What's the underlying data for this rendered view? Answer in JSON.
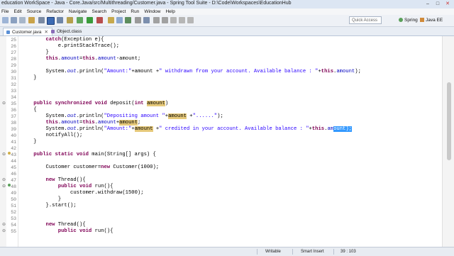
{
  "window": {
    "title": "education WorkSpace - Java - Core.Java/src/Multithreading/Customer.java - Spring Tool Suite - D:\\Code\\Workspaces\\EducationHub",
    "buttons": [
      "–",
      "□",
      "✕"
    ]
  },
  "menu": [
    "File",
    "Edit",
    "Source",
    "Refactor",
    "Navigate",
    "Search",
    "Project",
    "Run",
    "Window",
    "Help"
  ],
  "toolbar": {
    "quick_access_placeholder": "Quick Access",
    "perspectives": [
      {
        "label": "Spring",
        "icon": "spring-leaf-icon"
      },
      {
        "label": "Java EE",
        "icon": "java-ee-icon"
      }
    ]
  },
  "tabs": [
    {
      "label": "Customer.java",
      "icon": "java-file-icon",
      "active": true
    },
    {
      "label": "Object.class",
      "icon": "class-file-icon",
      "active": false
    }
  ],
  "code_lines": [
    {
      "num": "25",
      "html": "        <span class=\"kw\">catch</span>(Exception e){"
    },
    {
      "num": "26",
      "html": "            e.printStackTrace();"
    },
    {
      "num": "27",
      "html": "        }"
    },
    {
      "num": "28",
      "html": "        <span class=\"kw\">this</span>.<span class=\"fld\">amount</span>=<span class=\"kw\">this</span>.<span class=\"fld\">amount</span>-amount;"
    },
    {
      "num": "29",
      "html": ""
    },
    {
      "num": "30",
      "html": "        System.<span class=\"fld\"><i>out</i></span>.println(<span class=\"str\">\"Amount:\"</span>+amount +<span class=\"str\">\" withdrawn from your account. Available balance : \"</span>+<span class=\"kw\">this</span>.<span class=\"fld\">amount</span>);"
    },
    {
      "num": "31",
      "html": "    }"
    },
    {
      "num": "32",
      "html": ""
    },
    {
      "num": "33",
      "html": ""
    },
    {
      "num": "34",
      "html": ""
    },
    {
      "num": "35",
      "html": "    <span class=\"kw\">public</span> <span class=\"kw\">synchronized</span> <span class=\"kw\">void</span> deposit(<span class=\"kw\">int</span> <span class=\"hl\">amount</span>)",
      "fold": "⊖"
    },
    {
      "num": "36",
      "html": "    {"
    },
    {
      "num": "37",
      "html": "        System.<span class=\"fld\"><i>out</i></span>.println(<span class=\"str\">\"Depositing amount \"</span>+<span class=\"hl\">amount</span> +<span class=\"str\">\"......\"</span>);"
    },
    {
      "num": "38",
      "html": "        <span class=\"kw\">this</span>.<span class=\"fld\">amount</span>=<span class=\"kw\">this</span>.<span class=\"fld\">amount</span>+<span class=\"hl\">amount</span>;"
    },
    {
      "num": "39",
      "html": "        System.<span class=\"fld\"><i>out</i></span>.println(<span class=\"str\">\"Amount:\"</span>+<span class=\"hl\">amount</span> +<span class=\"str\">\" credited in your account. Available balance : \"</span>+<span class=\"kw\">this</span>.<span class=\"fld\">am</span><span class=\"sel\">ount);</span>"
    },
    {
      "num": "40",
      "html": "        notifyAll();"
    },
    {
      "num": "41",
      "html": "    }"
    },
    {
      "num": "42",
      "html": ""
    },
    {
      "num": "43",
      "html": "    <span class=\"kw\">public</span> <span class=\"kw\">static</span> <span class=\"kw\">void</span> main(String[] args) {",
      "fold": "⊖"
    },
    {
      "num": "44",
      "html": ""
    },
    {
      "num": "45",
      "html": "        Customer customer=<span class=\"kw\">new</span> Customer(1000);"
    },
    {
      "num": "46",
      "html": ""
    },
    {
      "num": "47",
      "html": "        <span class=\"kw\">new</span> Thread(){",
      "fold": "⊖"
    },
    {
      "num": "48",
      "html": "            <span class=\"kw\">public</span> <span class=\"kw\">void</span> run(){",
      "fold": "⊖"
    },
    {
      "num": "49",
      "html": "                customer.withdraw(1500);"
    },
    {
      "num": "50",
      "html": "            }"
    },
    {
      "num": "51",
      "html": "        }.start();"
    },
    {
      "num": "52",
      "html": ""
    },
    {
      "num": "53",
      "html": ""
    },
    {
      "num": "54",
      "html": "        <span class=\"kw\">new</span> Thread(){",
      "fold": "⊖"
    },
    {
      "num": "55",
      "html": "            <span class=\"kw\">public</span> <span class=\"kw\">void</span> run(){",
      "fold": "⊖"
    }
  ],
  "status": {
    "mode": "Writable",
    "insert": "Smart Insert",
    "position": "39 : 103"
  },
  "colors": {
    "keyword": "#7f0055",
    "string": "#2a00ff",
    "field": "#0000c0",
    "occurrence_highlight": "#e6c97a",
    "selection": "#3399ff"
  }
}
